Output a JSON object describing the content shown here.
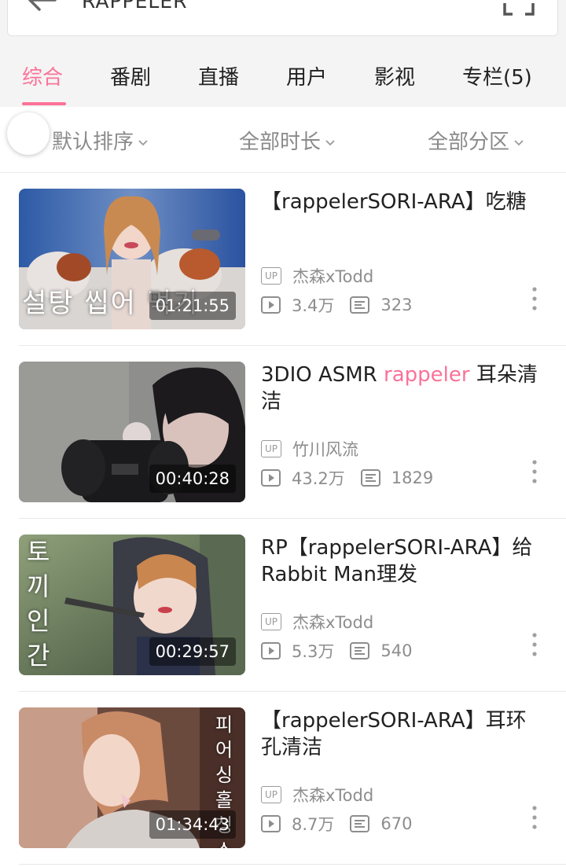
{
  "search": {
    "query": "RAPPELER"
  },
  "tabs": [
    {
      "label": "综合",
      "active": true
    },
    {
      "label": "番剧",
      "active": false
    },
    {
      "label": "直播",
      "active": false
    },
    {
      "label": "用户",
      "active": false
    },
    {
      "label": "影视",
      "active": false
    },
    {
      "label": "专栏(5)",
      "active": false
    }
  ],
  "filters": {
    "sort": "默认排序",
    "duration": "全部时长",
    "zone": "全部分区"
  },
  "colors": {
    "accent": "#fb7299",
    "muted": "#8d8d8d"
  },
  "results": [
    {
      "title": "【rappelerSORI-ARA】吃糖",
      "up": "杰森xTodd",
      "views": "3.4万",
      "danmaku": "323",
      "duration": "01:21:55",
      "thumb_text": "설탕 씹어 먹기"
    },
    {
      "title_prefix": "3DIO ASMR ",
      "title_highlight": "rappeler",
      "title_suffix": " 耳朵清洁",
      "up": "竹川风流",
      "views": "43.2万",
      "danmaku": "1829",
      "duration": "00:40:28"
    },
    {
      "title": "RP【rappelerSORI-ARA】给Rabbit Man理发",
      "up": "杰森xTodd",
      "views": "5.3万",
      "danmaku": "540",
      "duration": "00:29:57",
      "thumb_text": "토끼인간"
    },
    {
      "title": "【rappelerSORI-ARA】耳环孔清洁",
      "up": "杰森xTodd",
      "views": "8.7万",
      "danmaku": "670",
      "duration": "01:34:43",
      "thumb_text": "피어싱홀청소"
    }
  ],
  "labels": {
    "up_badge": "UP"
  }
}
